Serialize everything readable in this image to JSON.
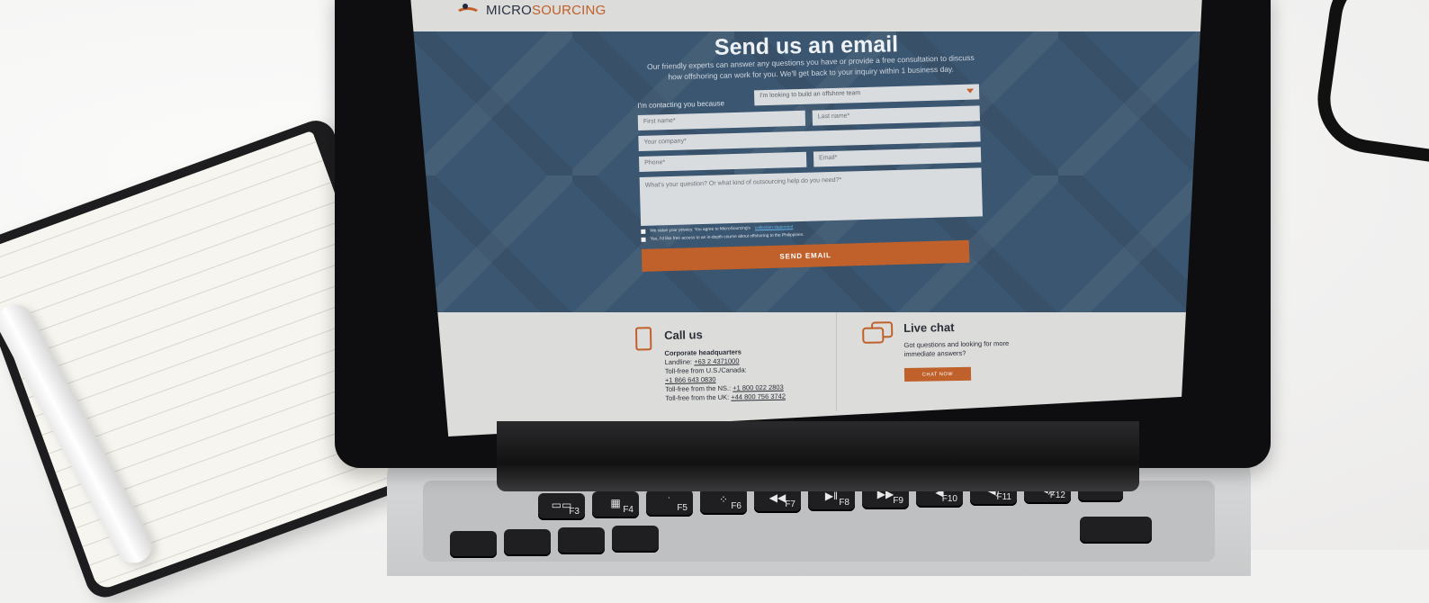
{
  "header": {
    "logo_prefix": "MICRO",
    "logo_suffix": "SOURCING"
  },
  "hero": {
    "title": "Send us an email",
    "subtitle": "Our friendly experts can answer any questions you have or provide a free consultation to discuss how offshoring can work for you. We'll get back to your inquiry within 1 business day."
  },
  "form": {
    "contact_label": "I'm contacting you because",
    "reason_selected": "I'm looking to build an offshore team",
    "first_name_placeholder": "First name*",
    "last_name_placeholder": "Last name*",
    "company_placeholder": "Your company*",
    "phone_placeholder": "Phone*",
    "email_placeholder": "Email*",
    "question_placeholder": "What's your question? Or what kind of outsourcing help do you need?*",
    "privacy_text": "We value your privacy. You agree to MicroSourcing's",
    "privacy_link": "collection statement",
    "course_text": "Yes, I'd like free access to an in-depth course about offshoring to the Philippines.",
    "send_label": "SEND EMAIL"
  },
  "call": {
    "title": "Call us",
    "hq": "Corporate headquarters",
    "landline_label": "Landline:",
    "landline": "+63 2 4371000",
    "us_label": "Toll-free from U.S./Canada:",
    "us_number": "+1 866 643 0830",
    "ns_label": "Toll-free from the NS.:",
    "ns_number": "+1 800 022 2803",
    "uk_label": "Toll-free from the UK:",
    "uk_number": "+44 800 756 3742"
  },
  "chat": {
    "title": "Live chat",
    "subtitle": "Got questions and looking for more immediate answers?",
    "button": "CHAT NOW"
  },
  "keyboard": {
    "keys": [
      {
        "label": "F3",
        "icon": "mission-control-icon"
      },
      {
        "label": "F4",
        "icon": "launchpad-icon"
      },
      {
        "label": "F5",
        "icon": "keyboard-light-down-icon"
      },
      {
        "label": "F6",
        "icon": "keyboard-light-up-icon"
      },
      {
        "label": "F7",
        "icon": "rewind-icon"
      },
      {
        "label": "F8",
        "icon": "play-pause-icon"
      },
      {
        "label": "F9",
        "icon": "fast-forward-icon"
      },
      {
        "label": "F10",
        "icon": "mute-icon"
      },
      {
        "label": "F11",
        "icon": "volume-down-icon"
      },
      {
        "label": "F12",
        "icon": "volume-up-icon"
      },
      {
        "label": "",
        "icon": "power-icon"
      }
    ],
    "symbols": [
      "⏮",
      "⏯",
      "⏭",
      "◀",
      "◀)",
      "◀))",
      "⏻"
    ]
  }
}
